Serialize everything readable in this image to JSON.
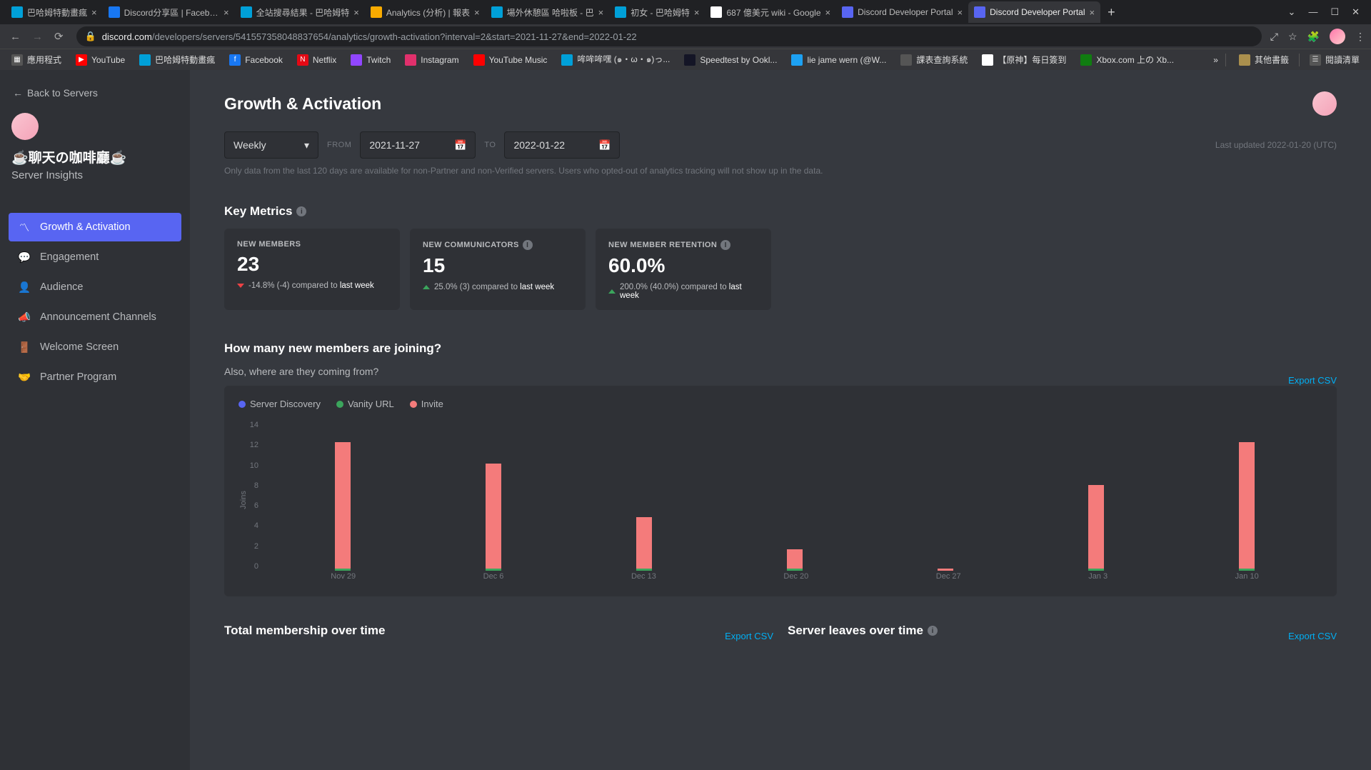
{
  "browser": {
    "tabs": [
      {
        "title": "巴哈姆特動畫瘋",
        "favicon_bg": "#00a0d8"
      },
      {
        "title": "Discord分享區 | Facebook",
        "favicon_bg": "#1877f2"
      },
      {
        "title": "全站搜尋結果 - 巴哈姆特",
        "favicon_bg": "#00a0d8"
      },
      {
        "title": "Analytics (分析) | 報表",
        "favicon_bg": "#f9ab00"
      },
      {
        "title": "場外休憩區 哈啦板 - 巴",
        "favicon_bg": "#00a0d8"
      },
      {
        "title": "初女 - 巴哈姆特",
        "favicon_bg": "#00a0d8"
      },
      {
        "title": "687 億美元 wiki - Google",
        "favicon_bg": "#fff"
      },
      {
        "title": "Discord Developer Portal",
        "favicon_bg": "#5865f2"
      },
      {
        "title": "Discord Developer Portal",
        "favicon_bg": "#5865f2",
        "active": true
      }
    ],
    "url_domain": "discord.com",
    "url_path": "/developers/servers/541557358048837654/analytics/growth-activation?interval=2&start=2021-11-27&end=2022-01-22",
    "bookmarks": [
      {
        "label": "應用程式",
        "icon": "▦",
        "bg": "#555"
      },
      {
        "label": "YouTube",
        "icon": "▶",
        "bg": "#f00"
      },
      {
        "label": "巴哈姆特動畫瘋",
        "icon": "",
        "bg": "#00a0d8"
      },
      {
        "label": "Facebook",
        "icon": "f",
        "bg": "#1877f2"
      },
      {
        "label": "Netflix",
        "icon": "N",
        "bg": "#e50914"
      },
      {
        "label": "Twitch",
        "icon": "",
        "bg": "#9146ff"
      },
      {
        "label": "Instagram",
        "icon": "",
        "bg": "#e1306c"
      },
      {
        "label": "YouTube Music",
        "icon": "",
        "bg": "#f00"
      },
      {
        "label": "哞哞哞嘿 (๑・ω・๑)っ...",
        "icon": "",
        "bg": "#00a0d8"
      },
      {
        "label": "Speedtest by Ookl...",
        "icon": "",
        "bg": "#141526"
      },
      {
        "label": "lie jame wern (@W...",
        "icon": "",
        "bg": "#1da1f2"
      },
      {
        "label": "課表查詢系統",
        "icon": "",
        "bg": "#555"
      },
      {
        "label": "【原神】每日簽到",
        "icon": "",
        "bg": "#fff"
      },
      {
        "label": "Xbox.com 上の Xb...",
        "icon": "",
        "bg": "#107c10"
      }
    ],
    "bm_more": "»",
    "bm_folder": "其他書籤",
    "bm_readlist": "閱讀清單"
  },
  "sidebar": {
    "back": "Back to Servers",
    "server_name": "☕聊天の咖啡廳☕",
    "server_sub": "Server Insights",
    "items": [
      {
        "label": "Growth & Activation",
        "active": true,
        "icon": "trend"
      },
      {
        "label": "Engagement",
        "icon": "chat"
      },
      {
        "label": "Audience",
        "icon": "person"
      },
      {
        "label": "Announcement Channels",
        "icon": "megaphone"
      },
      {
        "label": "Welcome Screen",
        "icon": "welcome"
      },
      {
        "label": "Partner Program",
        "icon": "partner"
      }
    ]
  },
  "page": {
    "title": "Growth & Activation",
    "interval": "Weekly",
    "from_label": "FROM",
    "to_label": "TO",
    "from_date": "2021-11-27",
    "to_date": "2022-01-22",
    "last_updated": "Last updated 2022-01-20 (UTC)",
    "disclaimer": "Only data from the last 120 days are available for non-Partner and non-Verified servers. Users who opted-out of analytics tracking will not show up in the data.",
    "key_metrics_title": "Key Metrics",
    "metrics": [
      {
        "label": "NEW MEMBERS",
        "value": "23",
        "dir": "down",
        "delta": "-14.8% (-4) compared to",
        "delta_strong": "last week",
        "info": false
      },
      {
        "label": "NEW COMMUNICATORS",
        "value": "15",
        "dir": "up",
        "delta": "25.0% (3) compared to",
        "delta_strong": "last week",
        "info": true
      },
      {
        "label": "NEW MEMBER RETENTION",
        "value": "60.0%",
        "dir": "up",
        "delta": "200.0% (40.0%) compared to",
        "delta_strong": "last week",
        "info": true
      }
    ],
    "chart_title": "How many new members are joining?",
    "chart_sub": "Also, where are they coming from?",
    "export": "Export CSV",
    "legend": [
      {
        "label": "Server Discovery",
        "color": "#5865f2"
      },
      {
        "label": "Vanity URL",
        "color": "#3ba55c"
      },
      {
        "label": "Invite",
        "color": "#f47b7b"
      }
    ],
    "totals_title": "Total membership over time",
    "leaves_title": "Server leaves over time"
  },
  "chart_data": {
    "type": "bar",
    "title": "How many new members are joining?",
    "ylabel": "Joins",
    "xlabel": "",
    "ylim": [
      0,
      14
    ],
    "yticks": [
      0,
      2,
      4,
      6,
      8,
      10,
      12,
      14
    ],
    "categories": [
      "Nov 29",
      "Dec 6",
      "Dec 13",
      "Dec 20",
      "Dec 27",
      "Jan 3",
      "Jan 10"
    ],
    "series": [
      {
        "name": "Server Discovery",
        "color": "#5865f2",
        "values": [
          0,
          0,
          0,
          0,
          0,
          0,
          0
        ]
      },
      {
        "name": "Vanity URL",
        "color": "#3ba55c",
        "values": [
          0.2,
          0.2,
          0.2,
          0.2,
          0,
          0.2,
          0.2
        ]
      },
      {
        "name": "Invite",
        "color": "#f47b7b",
        "values": [
          11.8,
          9.8,
          4.8,
          1.8,
          0.2,
          7.8,
          11.8
        ]
      }
    ]
  }
}
